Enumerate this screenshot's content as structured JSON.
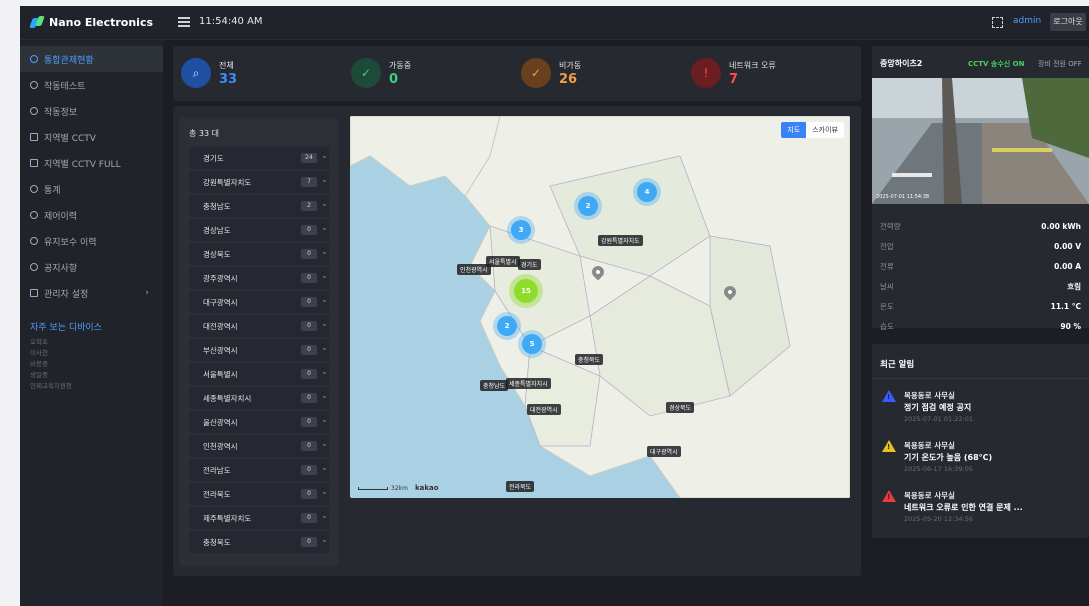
{
  "header": {
    "brand": "Nano Electronics",
    "clock": "11:54:40 AM",
    "user": "admin",
    "logout_label": "로그아웃"
  },
  "sidebar": {
    "items": [
      {
        "label": "통합관제현황",
        "active": true
      },
      {
        "label": "작동테스트"
      },
      {
        "label": "작동정보"
      },
      {
        "label": "지역별 CCTV"
      },
      {
        "label": "지역별 CCTV FULL"
      },
      {
        "label": "통계"
      },
      {
        "label": "제어이력"
      },
      {
        "label": "유지보수 이력"
      },
      {
        "label": "공지사항"
      },
      {
        "label": "관리자 설정",
        "has_children": true
      }
    ],
    "favorites_title": "자주 보는 디바이스",
    "favorites": [
      "오학초",
      "이사현",
      "비봉중",
      "생일중",
      "인제교육지원청"
    ]
  },
  "stats": [
    {
      "label": "전체",
      "value": "33",
      "color": "#3b8cff",
      "icon": "search-icon"
    },
    {
      "label": "가동중",
      "value": "0",
      "color": "#3fd07f",
      "icon": "check-circle-icon"
    },
    {
      "label": "비가동",
      "value": "26",
      "color": "#f0a04b",
      "icon": "check-circle-icon"
    },
    {
      "label": "네트워크 오류",
      "value": "7",
      "color": "#ff4b4b",
      "icon": "alert-circle-icon"
    }
  ],
  "regions": {
    "total_label": "총 33 대",
    "items": [
      {
        "name": "경기도",
        "count": "24"
      },
      {
        "name": "강원특별자치도",
        "count": "7"
      },
      {
        "name": "충청남도",
        "count": "2"
      },
      {
        "name": "경상남도",
        "count": "0"
      },
      {
        "name": "경상북도",
        "count": "0"
      },
      {
        "name": "광주광역시",
        "count": "0"
      },
      {
        "name": "대구광역시",
        "count": "0"
      },
      {
        "name": "대전광역시",
        "count": "0"
      },
      {
        "name": "부산광역시",
        "count": "0"
      },
      {
        "name": "서울특별시",
        "count": "0"
      },
      {
        "name": "세종특별자치시",
        "count": "0"
      },
      {
        "name": "울산광역시",
        "count": "0"
      },
      {
        "name": "인천광역시",
        "count": "0"
      },
      {
        "name": "전라남도",
        "count": "0"
      },
      {
        "name": "전라북도",
        "count": "0"
      },
      {
        "name": "제주특별자치도",
        "count": "0"
      },
      {
        "name": "충청북도",
        "count": "0"
      }
    ]
  },
  "map": {
    "toggle": [
      "지도",
      "스카이뷰"
    ],
    "clusters": [
      "3",
      "2",
      "4",
      "15",
      "2",
      "5"
    ],
    "labels": [
      "강원특별자치도",
      "서울특별시",
      "경기도",
      "인천광역시",
      "충청북도",
      "충청남도",
      "세종특별자치시",
      "대전광역시",
      "경상북도",
      "대구광역시",
      "전라북도"
    ],
    "scale": "32km",
    "attribution": "kakao"
  },
  "camera": {
    "title": "중앙하이츠2",
    "status": "CCTV 송수신 ON",
    "power": "장비 전원 OFF",
    "stamp": "2025-07-01 11:54:38",
    "metrics": [
      {
        "key": "전력량",
        "value": "0.00 kWh"
      },
      {
        "key": "전압",
        "value": "0.00 V"
      },
      {
        "key": "전류",
        "value": "0.00 A"
      },
      {
        "key": "날씨",
        "value": "흐림"
      },
      {
        "key": "온도",
        "value": "11.1 °C"
      },
      {
        "key": "습도",
        "value": "90 %"
      }
    ]
  },
  "alerts": {
    "title": "최근 알림",
    "items": [
      {
        "source": "복용동로 사무실",
        "message": "정기 점검 예정 공지",
        "time": "2025-07-01 01:22:01",
        "color": "#3b5bff"
      },
      {
        "source": "복용동로 사무실",
        "message": "기기 온도가 높음 (68°C)",
        "time": "2025-06-17 16:39:05",
        "color": "#e8c21e"
      },
      {
        "source": "복용동로 사무실",
        "message": "네트워크 오류로 인한 연결 문제 ...",
        "time": "2025-05-20 12:34:56",
        "color": "#e83b3b"
      }
    ]
  }
}
